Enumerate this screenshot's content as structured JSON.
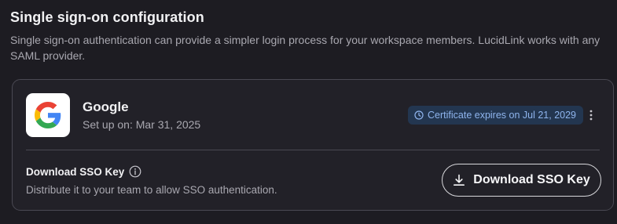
{
  "section": {
    "title": "Single sign-on configuration",
    "description": "Single sign-on authentication can provide a simpler login process for your workspace members. LucidLink works with any SAML provider."
  },
  "provider": {
    "name": "Google",
    "setup_text": "Set up on: Mar 31, 2025",
    "logo_icon": "google-logo",
    "certificate_badge": "Certificate expires on Jul 21, 2029",
    "badge_icon": "clock-icon",
    "menu_icon": "kebab-menu-icon"
  },
  "download": {
    "label": "Download SSO Key",
    "info_icon": "info-icon",
    "description": "Distribute it to your team to allow SSO authentication.",
    "button_label": "Download SSO Key",
    "button_icon": "download-icon"
  },
  "colors": {
    "background": "#1d1c22",
    "card_border": "#4a4953",
    "badge_bg": "#233650",
    "badge_text": "#8fb5ee"
  }
}
